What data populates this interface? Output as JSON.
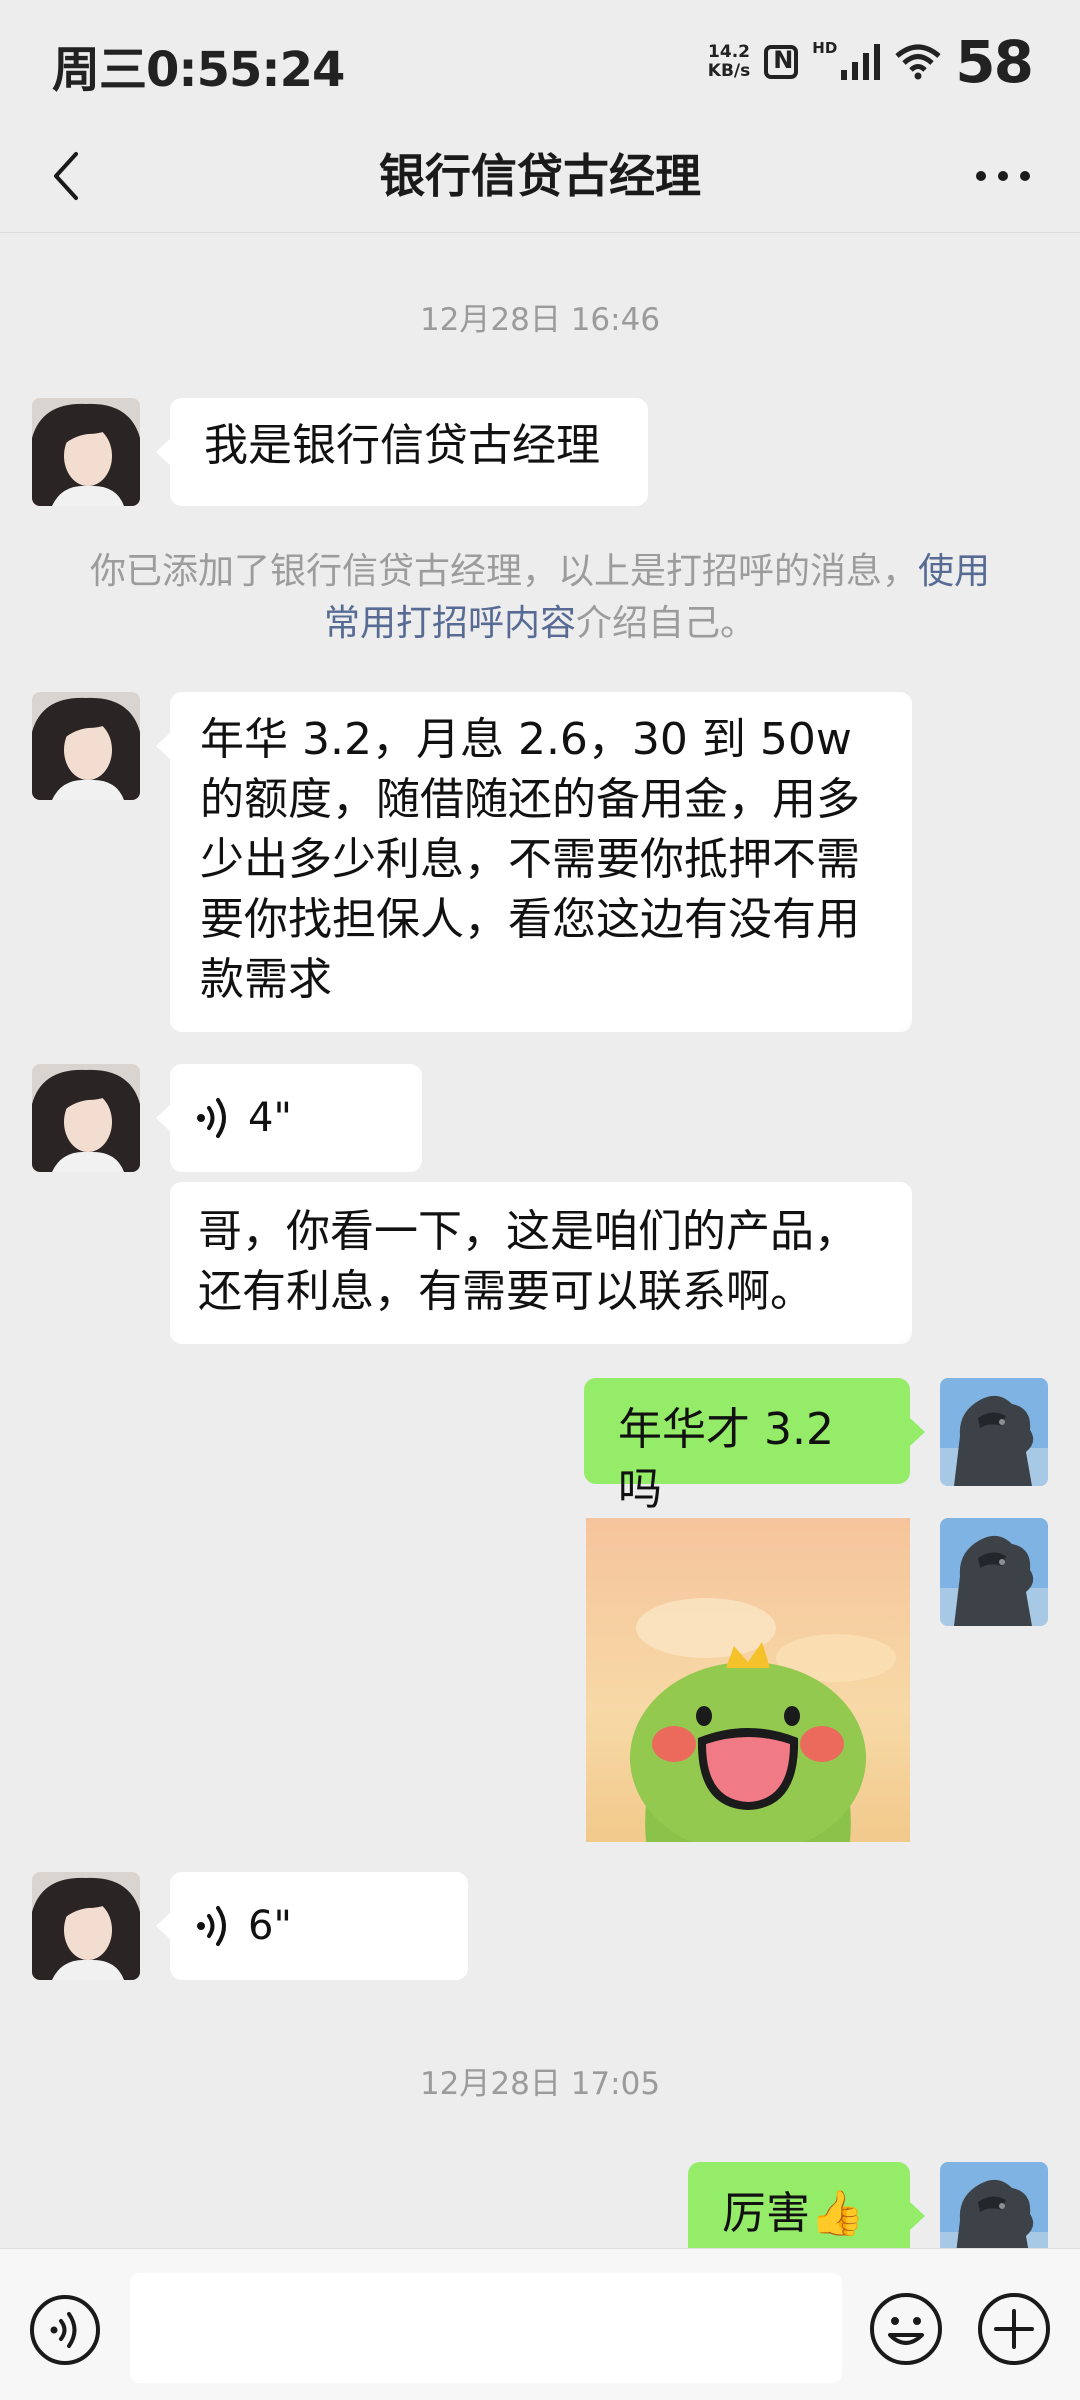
{
  "status_bar": {
    "time": "周三0:55:24",
    "net_speed_value": "14.2",
    "net_speed_unit": "KB/s",
    "hd_label": "HD",
    "battery": "58"
  },
  "header": {
    "title": "银行信贷古经理"
  },
  "messages": {
    "timestamp_1": "12月28日 16:46",
    "msg_1": "我是银行信贷古经理",
    "system_note_prefix": "你已添加了银行信贷古经理，以上是打招呼的消息，",
    "system_note_link": "使用常用打招呼内容",
    "system_note_suffix": "介绍自己。",
    "msg_2": "年华 3.2，月息 2.6，30 到 50w 的额度，随借随还的备用金，用多少出多少利息，不需要你抵押不需要你找担保人，看您这边有没有用款需求",
    "voice_1_duration": "4\"",
    "msg_3": "哥，你看一下，这是咱们的产品，还有利息，有需要可以联系啊。",
    "msg_4": "年华才 3.2 吗",
    "voice_2_duration": "6\"",
    "timestamp_2": "12月28日 17:05",
    "msg_5": "厉害👍"
  },
  "colors": {
    "background": "#ededed",
    "sent_bubble": "#95ec69",
    "received_bubble": "#ffffff",
    "link": "#576b95",
    "timestamp": "#9b9b9b"
  },
  "icons": [
    "back-arrow-icon",
    "more-icon",
    "voice-wave-icon",
    "voice-input-icon",
    "emoji-icon",
    "plus-icon",
    "nfc-icon",
    "signal-icon",
    "wifi-icon"
  ]
}
